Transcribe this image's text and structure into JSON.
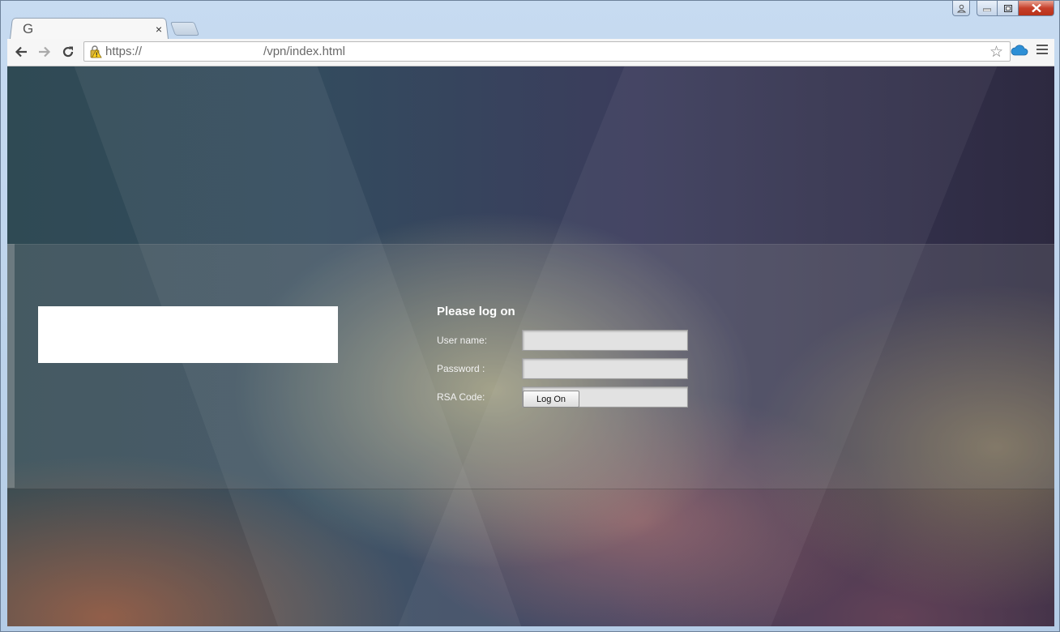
{
  "browser": {
    "tab": {
      "favicon_letter": "G",
      "title": "",
      "close_glyph": "×"
    },
    "address_bar": {
      "scheme": "https://",
      "path": "/vpn/index.html"
    },
    "icons": [
      "back-icon",
      "forward-icon",
      "reload-icon",
      "warning-lock-icon",
      "star-icon",
      "cloud-icon",
      "menu-icon",
      "user-icon",
      "minimize-icon",
      "maximize-icon",
      "close-icon"
    ]
  },
  "login": {
    "title": "Please log on",
    "fields": [
      {
        "label": "User name:",
        "value": ""
      },
      {
        "label": "Password :",
        "value": ""
      },
      {
        "label": "RSA Code:",
        "value": ""
      }
    ],
    "submit_label": "Log On"
  },
  "colors": {
    "accent_close": "#c6402b",
    "page_dark": "#2d2940",
    "page_teal": "#2f4a54"
  }
}
